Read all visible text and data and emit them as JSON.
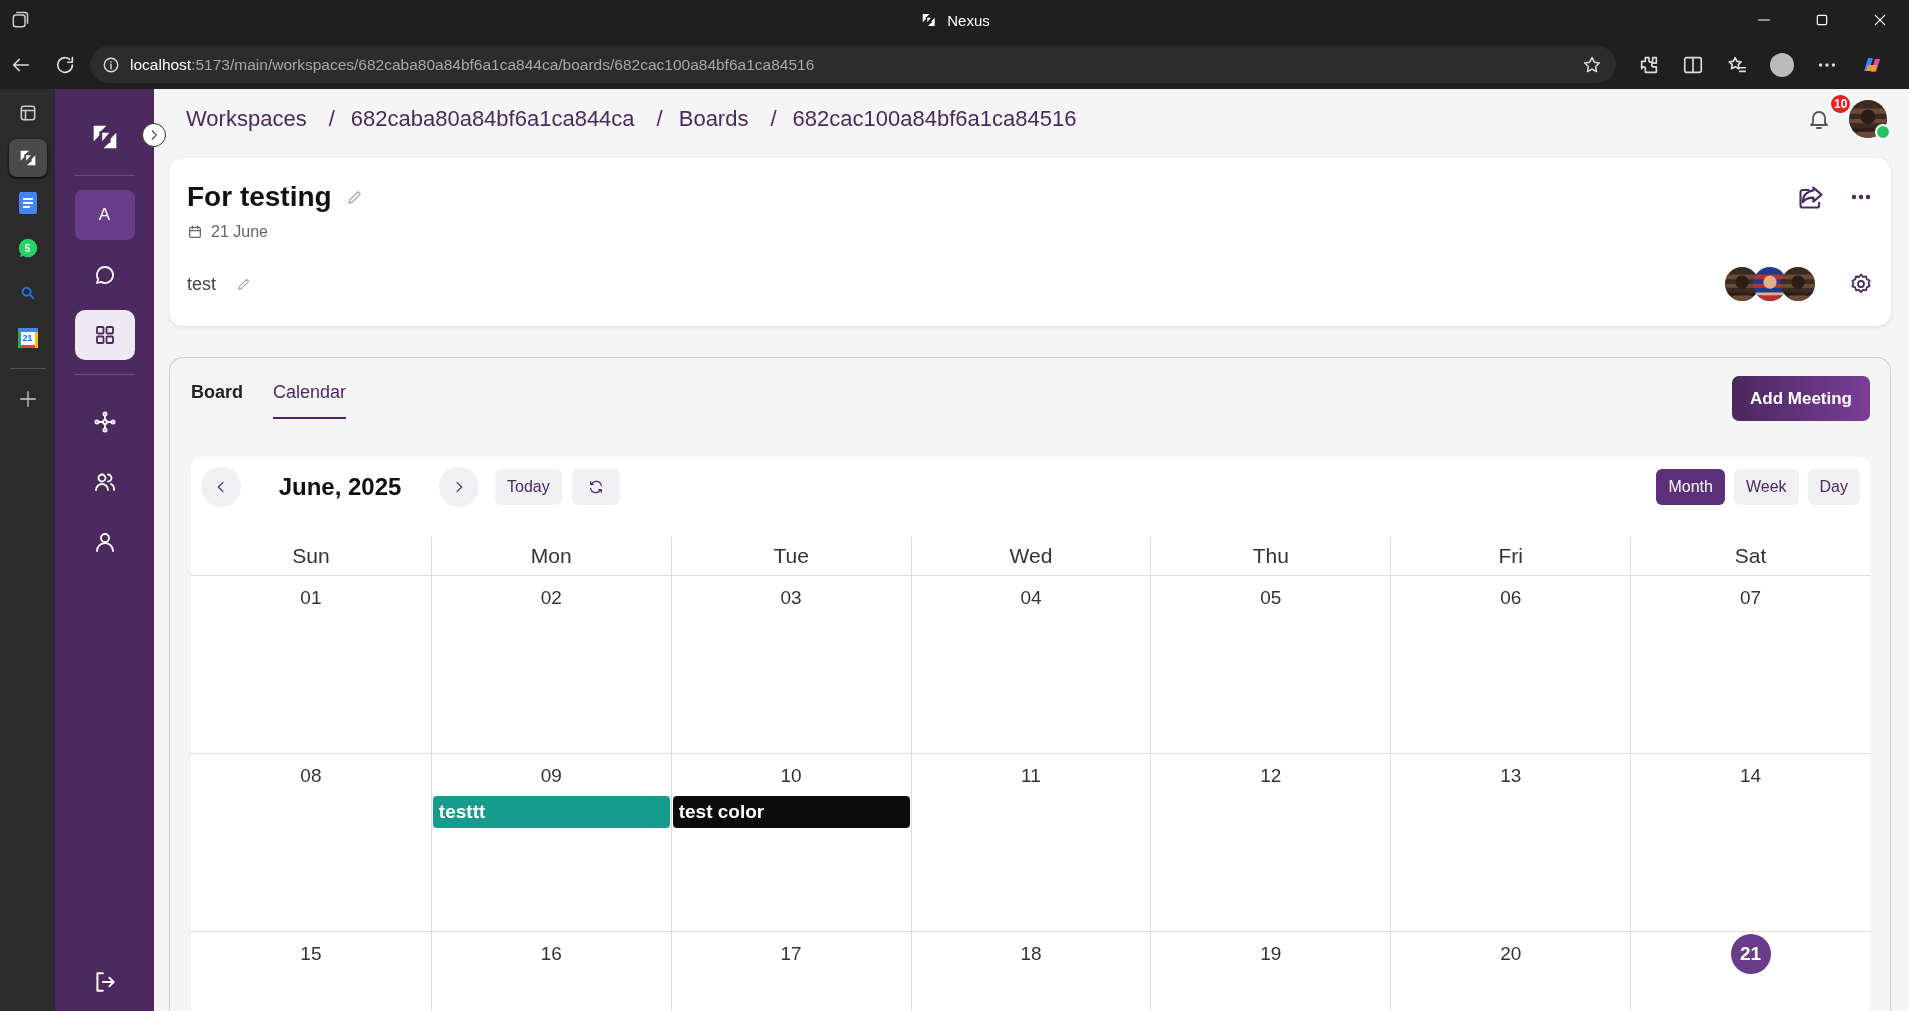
{
  "browser": {
    "title": "Nexus",
    "url_host": "localhost",
    "url_path": ":5173/main/workspaces/682caba80a84bf6a1ca844ca/boards/682cac100a84bf6a1ca84516",
    "side_apps": [
      {
        "kind": "nexus",
        "selected": true
      },
      {
        "kind": "docs",
        "selected": false
      },
      {
        "kind": "whatsapp",
        "badge": "5",
        "selected": false
      },
      {
        "kind": "search",
        "selected": false
      },
      {
        "kind": "calendar",
        "badge": "21",
        "selected": false
      }
    ]
  },
  "sidebar": {
    "workspace": "A",
    "items_top": [
      {
        "kind": "chat",
        "selected": false
      },
      {
        "kind": "boards",
        "selected": true
      }
    ],
    "items_bottom": [
      {
        "kind": "network",
        "selected": false
      },
      {
        "kind": "team",
        "selected": false
      },
      {
        "kind": "profile",
        "selected": false
      }
    ]
  },
  "breadcrumbs": [
    {
      "label": "Workspaces"
    },
    {
      "separator": "/",
      "label": "682caba80a84bf6a1ca844ca"
    },
    {
      "separator": "/",
      "label": "Boards"
    },
    {
      "separator": "/",
      "label": "682cac100a84bf6a1ca84516"
    }
  ],
  "notifications": "10",
  "user_online": true,
  "board": {
    "title": "For testing",
    "date": "21 June",
    "description": "test"
  },
  "tabs": [
    {
      "label": "Board",
      "selected": false
    },
    {
      "label": "Calendar",
      "selected": true
    }
  ],
  "add_button": "Add Meeting",
  "calendar": {
    "month": "June, 2025",
    "today_button": "Today",
    "views": [
      {
        "label": "Month",
        "selected": true
      },
      {
        "label": "Week",
        "selected": false
      },
      {
        "label": "Day",
        "selected": false
      }
    ],
    "weekdays": [
      "Sun",
      "Mon",
      "Tue",
      "Wed",
      "Thu",
      "Fri",
      "Sat"
    ],
    "weeks": [
      [
        {
          "day": "01",
          "today": false
        },
        {
          "day": "02",
          "today": false
        },
        {
          "day": "03",
          "today": false
        },
        {
          "day": "04",
          "today": false
        },
        {
          "day": "05",
          "today": false
        },
        {
          "day": "06",
          "today": false
        },
        {
          "day": "07",
          "today": false
        }
      ],
      [
        {
          "day": "08",
          "today": false
        },
        {
          "day": "09",
          "today": false,
          "events": [
            {
              "title": "testtt",
              "color": "#179b8c"
            }
          ]
        },
        {
          "day": "10",
          "today": false,
          "events": [
            {
              "title": "test color",
              "color": "#0c0c0c"
            }
          ]
        },
        {
          "day": "11",
          "today": false
        },
        {
          "day": "12",
          "today": false
        },
        {
          "day": "13",
          "today": false
        },
        {
          "day": "14",
          "today": false
        }
      ],
      [
        {
          "day": "15",
          "today": false
        },
        {
          "day": "16",
          "today": false
        },
        {
          "day": "17",
          "today": false
        },
        {
          "day": "18",
          "today": false
        },
        {
          "day": "19",
          "today": false
        },
        {
          "day": "20",
          "today": false
        },
        {
          "day": "21",
          "today": true
        }
      ]
    ]
  }
}
